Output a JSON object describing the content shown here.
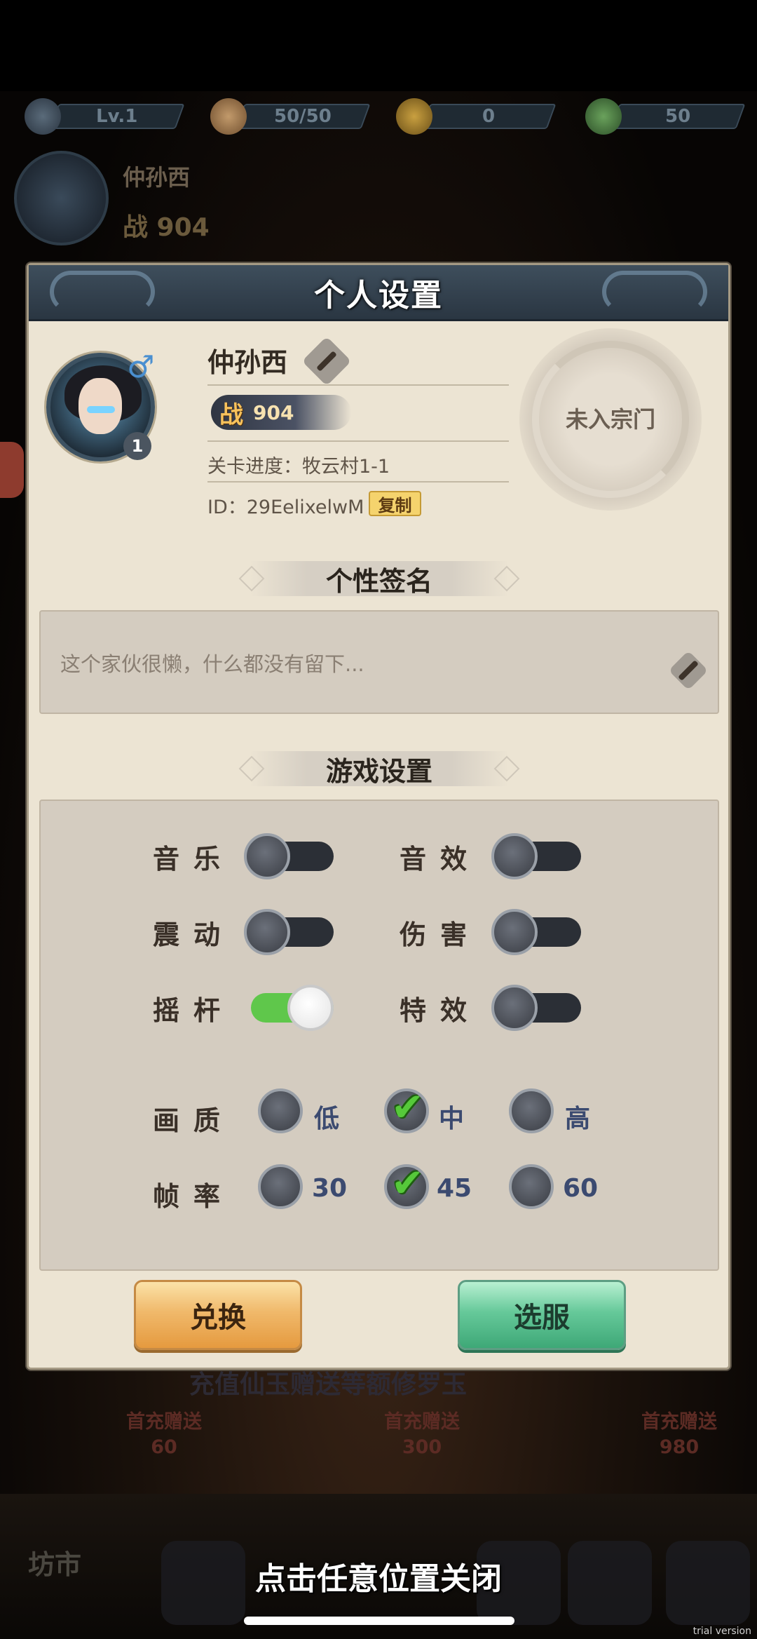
{
  "hud": {
    "level": "Lv.1",
    "stamina": "50/50",
    "coins": "0",
    "jade": "50"
  },
  "background": {
    "player_name": "仲孙西",
    "power": "战 904",
    "promo_text": "充值仙玉赠送等额修罗玉",
    "packs": [
      {
        "label": "首充赠送",
        "amount": "60"
      },
      {
        "label": "首充赠送",
        "amount": "300"
      },
      {
        "label": "首充赠送",
        "amount": "980"
      }
    ],
    "market_label": "坊市"
  },
  "modal": {
    "title": "个人设置",
    "profile": {
      "gender_symbol": "♂",
      "level": "1",
      "name": "仲孙西",
      "power_label": "战",
      "power_value": "904",
      "stage": "关卡进度：牧云村1-1",
      "id": "ID：29EelixelwM",
      "copy_label": "复制",
      "sect_status": "未入宗门"
    },
    "signature": {
      "header": "个性签名",
      "text": "这个家伙很懒，什么都没有留下..."
    },
    "settings": {
      "header": "游戏设置",
      "toggles": [
        {
          "label": "音乐",
          "on": false
        },
        {
          "label": "音效",
          "on": false
        },
        {
          "label": "震动",
          "on": false
        },
        {
          "label": "伤害",
          "on": false
        },
        {
          "label": "摇杆",
          "on": true
        },
        {
          "label": "特效",
          "on": false
        }
      ],
      "quality": {
        "label": "画质",
        "options": [
          "低",
          "中",
          "高"
        ],
        "selected": "中"
      },
      "framerate": {
        "label": "帧率",
        "options": [
          "30",
          "45",
          "60"
        ],
        "selected": "45"
      }
    },
    "buttons": {
      "exchange": "兑换",
      "server": "选服"
    }
  },
  "close_hint": "点击任意位置关闭",
  "watermark": "trial version",
  "colors": {
    "toggle_on": "#5fc74b",
    "check": "#56c93a",
    "modal_bg": "#ece4d3",
    "header_bg": "#2a3642"
  }
}
